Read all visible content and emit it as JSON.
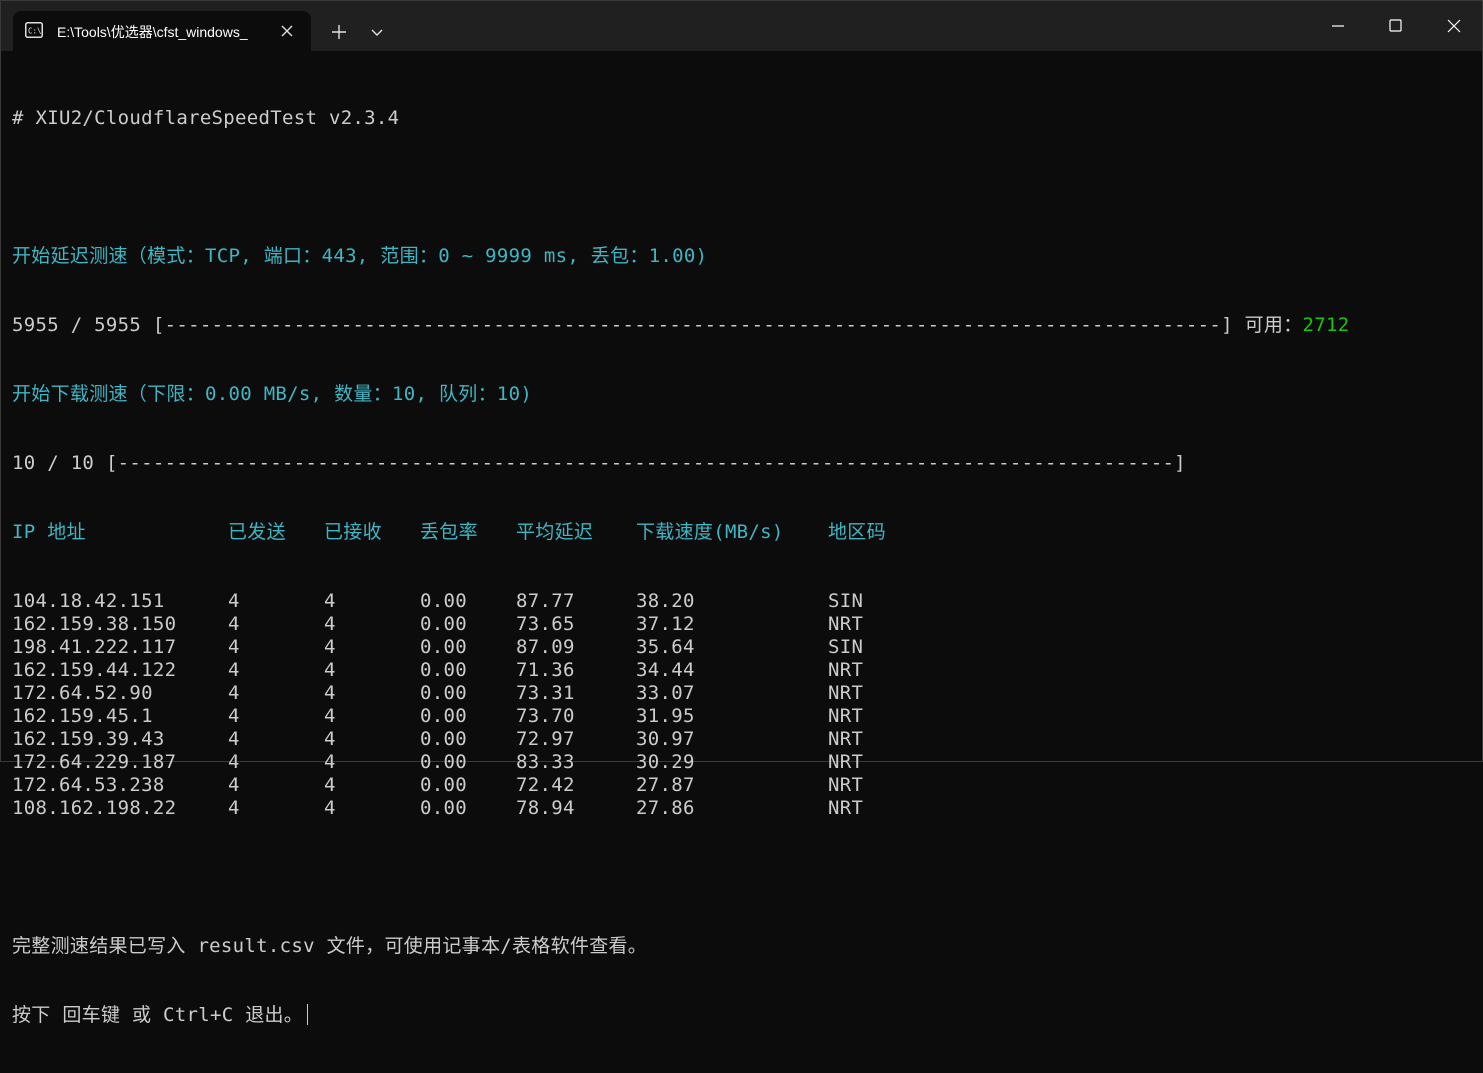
{
  "window": {
    "tab_title": "E:\\Tools\\优选器\\cfst_windows_",
    "new_tab_symbol": "+",
    "accent_cyan": "#3fb6c4",
    "accent_green": "#16c60c",
    "background": "#0c0c0c"
  },
  "terminal": {
    "version_line": "# XIU2/CloudflareSpeedTest v2.3.4",
    "latency_start": "开始延迟测速（模式：TCP, 端口：443, 范围：0 ~ 9999 ms, 丢包：1.00)",
    "latency_progress_count": "5955 / 5955",
    "latency_progress_bar": "[------------------------------------------------------------------------------------------]",
    "available_label": "可用：",
    "available_value": "2712",
    "download_start": "开始下载测速（下限：0.00 MB/s, 数量：10, 队列：10)",
    "download_progress_count": "10 / 10",
    "download_progress_bar": "[------------------------------------------------------------------------------------------]",
    "table_headers": [
      "IP 地址",
      "已发送",
      "已接收",
      "丢包率",
      "平均延迟",
      "下载速度(MB/s)",
      "地区码"
    ],
    "rows": [
      [
        "104.18.42.151",
        "4",
        "4",
        "0.00",
        "87.77",
        "38.20",
        "SIN"
      ],
      [
        "162.159.38.150",
        "4",
        "4",
        "0.00",
        "73.65",
        "37.12",
        "NRT"
      ],
      [
        "198.41.222.117",
        "4",
        "4",
        "0.00",
        "87.09",
        "35.64",
        "SIN"
      ],
      [
        "162.159.44.122",
        "4",
        "4",
        "0.00",
        "71.36",
        "34.44",
        "NRT"
      ],
      [
        "172.64.52.90",
        "4",
        "4",
        "0.00",
        "73.31",
        "33.07",
        "NRT"
      ],
      [
        "162.159.45.1",
        "4",
        "4",
        "0.00",
        "73.70",
        "31.95",
        "NRT"
      ],
      [
        "162.159.39.43",
        "4",
        "4",
        "0.00",
        "72.97",
        "30.97",
        "NRT"
      ],
      [
        "172.64.229.187",
        "4",
        "4",
        "0.00",
        "83.33",
        "30.29",
        "NRT"
      ],
      [
        "172.64.53.238",
        "4",
        "4",
        "0.00",
        "72.42",
        "27.87",
        "NRT"
      ],
      [
        "108.162.198.22",
        "4",
        "4",
        "0.00",
        "78.94",
        "27.86",
        "NRT"
      ]
    ],
    "result_message": "完整测速结果已写入 result.csv 文件，可使用记事本/表格软件查看。",
    "exit_prompt": "按下 回车键 或 Ctrl+C 退出。"
  }
}
